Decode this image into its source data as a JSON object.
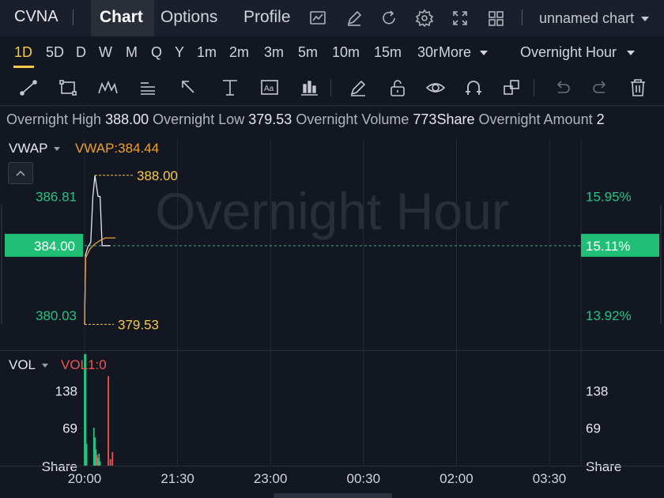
{
  "header": {
    "ticker": "CVNA",
    "tabs": [
      {
        "label": "Chart",
        "active": true
      },
      {
        "label": "Options",
        "active": false
      },
      {
        "label": "Profile",
        "active": false
      }
    ],
    "icons": [
      "chart-type-icon",
      "draw-icon",
      "refresh-icon",
      "settings-icon",
      "fullscreen-icon",
      "layout-grid-icon"
    ],
    "chart_name": "unnamed chart"
  },
  "intervals": {
    "items": [
      "1D",
      "5D",
      "D",
      "W",
      "M",
      "Q",
      "Y",
      "1m",
      "2m",
      "3m",
      "5m",
      "10m",
      "15m",
      "30r"
    ],
    "active": "1D",
    "more_label": "More",
    "session": "Overnight Hour"
  },
  "toolbar": {
    "icons": [
      "trend-line-icon",
      "rectangle-icon",
      "pattern-icon",
      "text-icon",
      "arrow-icon",
      "measure-icon",
      "annotation-icon",
      "indicator-icon",
      "pen-icon",
      "unlock-icon",
      "eye-icon",
      "magnet-icon",
      "layers-icon",
      "undo-icon",
      "redo-icon",
      "trash-icon"
    ]
  },
  "info_strip": {
    "high_label": "Overnight High",
    "high_value": "388.00",
    "low_label": "Overnight Low",
    "low_value": "379.53",
    "volume_label": "Overnight Volume",
    "volume_value": "773Share",
    "amount_label": "Overnight Amount",
    "amount_value": "2"
  },
  "colors": {
    "background": "#131722",
    "up": "#26c281",
    "down": "#ef5350",
    "accent": "#f7c948",
    "vwap": "#f0a030",
    "current_price_bg": "#1fbf75"
  },
  "chart_data": {
    "type": "line",
    "watermark": "Overnight Hour",
    "price_panel": {
      "indicator_name": "VWAP",
      "indicator_value_label": "VWAP:384.44",
      "ylim": [
        378.2,
        390.1
      ],
      "yticks": [
        380.03,
        386.81
      ],
      "ytick_labels": [
        "380.03",
        "386.81"
      ],
      "pct_tick_labels": [
        "13.92%",
        "15.95%"
      ],
      "current_price": 384.0,
      "current_price_label": "384.00",
      "current_pct_label": "15.11%",
      "high_value": 388.0,
      "high_label": "388.00",
      "low_value": 379.53,
      "low_label": "379.53",
      "price_series": {
        "x": [
          "20:00",
          "20:01",
          "20:03",
          "20:06",
          "20:08",
          "20:10",
          "20:13",
          "20:15",
          "20:17",
          "20:20",
          "20:25"
        ],
        "values": [
          379.53,
          383.5,
          383.9,
          384.2,
          386.8,
          388.0,
          386.8,
          386.8,
          384.0,
          384.0,
          384.0
        ]
      },
      "vwap_series": {
        "x": [
          "20:00",
          "20:01",
          "20:05",
          "20:10",
          "20:15",
          "20:20",
          "20:30"
        ],
        "values": [
          379.6,
          383.3,
          383.8,
          384.1,
          384.3,
          384.44,
          384.44
        ]
      }
    },
    "volume_panel": {
      "indicator_name": "VOL",
      "indicator_value_label": "VOL1:0",
      "ylim": [
        0,
        207
      ],
      "yticks": [
        69,
        138
      ],
      "ytick_labels": [
        "69",
        "138"
      ],
      "unit_label": "Share",
      "bars": [
        {
          "x": "20:00",
          "value": 205,
          "dir": "up"
        },
        {
          "x": "20:01",
          "value": 206,
          "dir": "up"
        },
        {
          "x": "20:02",
          "value": 40,
          "dir": "up"
        },
        {
          "x": "20:09",
          "value": 70,
          "dir": "up"
        },
        {
          "x": "20:10",
          "value": 52,
          "dir": "up"
        },
        {
          "x": "20:11",
          "value": 30,
          "dir": "up"
        },
        {
          "x": "20:12",
          "value": 20,
          "dir": "down"
        },
        {
          "x": "20:13",
          "value": 14,
          "dir": "up"
        },
        {
          "x": "20:14",
          "value": 22,
          "dir": "up"
        },
        {
          "x": "20:15",
          "value": 8,
          "dir": "up"
        },
        {
          "x": "20:23",
          "value": 165,
          "dir": "down"
        },
        {
          "x": "20:25",
          "value": 12,
          "dir": "down"
        },
        {
          "x": "20:27",
          "value": 25,
          "dir": "down"
        }
      ]
    },
    "x_axis": {
      "range": [
        "20:00",
        "03:50"
      ],
      "ticks": [
        "20:00",
        "21:30",
        "23:00",
        "00:30",
        "02:00",
        "03:30"
      ]
    }
  }
}
